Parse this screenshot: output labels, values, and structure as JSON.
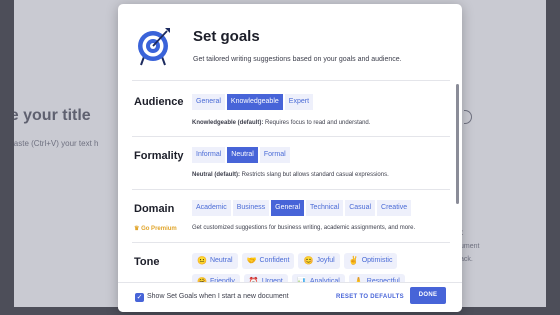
{
  "background": {
    "title_fragment": "pe your title",
    "hint_fragment": "or paste (Ctrl+V) your text h",
    "right_fragment_a": "t",
    "right_fragment_b": "ument",
    "right_fragment_c": "ack."
  },
  "modal": {
    "title": "Set goals",
    "subtitle": "Get tailored writing suggestions based on your goals and audience.",
    "icon": "target-icon"
  },
  "audience": {
    "label": "Audience",
    "options": [
      "General",
      "Knowledgeable",
      "Expert"
    ],
    "selected": "Knowledgeable",
    "desc_bold": "Knowledgeable (default):",
    "desc_rest": " Requires focus to read and understand."
  },
  "formality": {
    "label": "Formality",
    "options": [
      "Informal",
      "Neutral",
      "Formal"
    ],
    "selected": "Neutral",
    "desc_bold": "Neutral (default):",
    "desc_rest": " Restricts slang but allows standard casual expressions."
  },
  "domain": {
    "label": "Domain",
    "premium": "Go Premium",
    "options": [
      "Academic",
      "Business",
      "General",
      "Technical",
      "Casual",
      "Creative"
    ],
    "selected": "General",
    "desc": "Get customized suggestions for business writing, academic assignments, and more."
  },
  "tone": {
    "label": "Tone",
    "items": [
      {
        "emoji": "😐",
        "label": "Neutral"
      },
      {
        "emoji": "🤝",
        "label": "Confident"
      },
      {
        "emoji": "😊",
        "label": "Joyful"
      },
      {
        "emoji": "✌",
        "label": "Optimistic"
      },
      {
        "emoji": "🤗",
        "label": "Friendly"
      },
      {
        "emoji": "⏰",
        "label": "Urgent"
      },
      {
        "emoji": "📊",
        "label": "Analytical"
      },
      {
        "emoji": "🙏",
        "label": "Respectful"
      }
    ]
  },
  "footer": {
    "checkbox_label": "Show Set Goals when I start a new document",
    "reset": "RESET TO DEFAULTS",
    "done": "DONE"
  },
  "colors": {
    "accent": "#4764d8",
    "option_bg": "#eef0fb",
    "premium": "#e1a52b"
  }
}
